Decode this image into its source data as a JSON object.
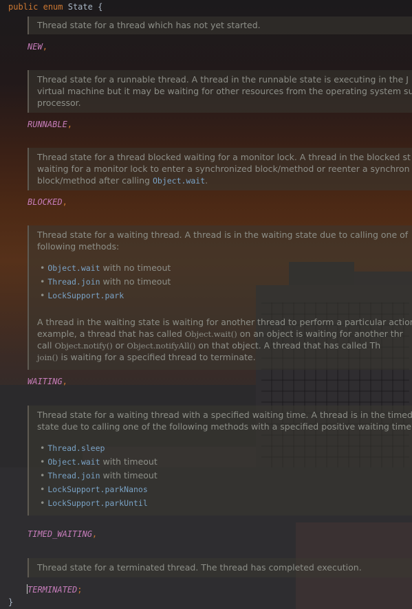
{
  "editor": {
    "header": {
      "kw1": "public",
      "kw2": "enum",
      "name": "State",
      "brace": "{"
    },
    "closing_brace": "}",
    "constants": [
      "NEW",
      "RUNNABLE",
      "BLOCKED",
      "WAITING",
      "TIMED_WAITING",
      "TERMINATED"
    ],
    "punct": {
      "comma": ",",
      "semi": ";"
    },
    "docs": {
      "new": "Thread state for a thread which has not yet started.",
      "runnable": [
        "Thread state for a runnable thread. A thread in the runnable state is executing in the J",
        "virtual machine but it may be waiting for other resources from the operating system su",
        "processor."
      ],
      "blocked": [
        "Thread state for a thread blocked waiting for a monitor lock. A thread in the blocked st",
        "waiting for a monitor lock to enter a synchronized block/method or reenter a synchron",
        "block/method after calling",
        "Object.wait",
        "."
      ],
      "waiting": {
        "intro": [
          "Thread state for a waiting thread. A thread is in the waiting state due to calling one of",
          "following methods:"
        ],
        "items": [
          {
            "code": "Object.wait",
            "text": " with no timeout"
          },
          {
            "code": "Thread.join",
            "text": " with no timeout"
          },
          {
            "code": "LockSupport.park",
            "text": ""
          }
        ],
        "para": {
          "l1": "A thread in the waiting state is waiting for another thread to perform a particular action",
          "l2a": "example, a thread that has called ",
          "l2b": "Object.wait()",
          "l2c": " on an object is waiting for another thr",
          "l3a": "call ",
          "l3b": "Object.notify()",
          "l3c": " or ",
          "l3d": "Object.notifyAll()",
          "l3e": " on that object. A thread that has called Th",
          "l4a": "join()",
          "l4b": " is waiting for a specified thread to terminate."
        }
      },
      "timed_waiting": {
        "intro": [
          "Thread state for a waiting thread with a specified waiting time. A thread is in the timed",
          "state due to calling one of the following methods with a specified positive waiting time"
        ],
        "items": [
          {
            "code": "Thread.sleep",
            "text": ""
          },
          {
            "code": "Object.wait",
            "text": " with timeout"
          },
          {
            "code": "Thread.join",
            "text": " with timeout"
          },
          {
            "code": "LockSupport.parkNanos",
            "text": ""
          },
          {
            "code": "LockSupport.parkUntil",
            "text": ""
          }
        ]
      },
      "terminated": "Thread state for a terminated thread. The thread has completed execution."
    }
  }
}
